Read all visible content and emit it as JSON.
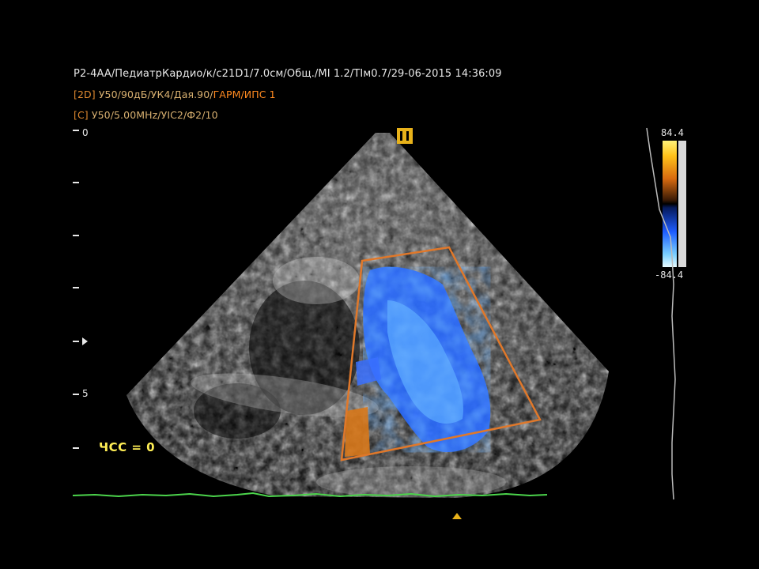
{
  "header": {
    "line1": "P2-4AA/ПедиатрКардио/к/c21D1/7.0см/Общ./MI 1.2/TIм0.7/29-06-2015 14:36:09",
    "line2_tag": "[2D]",
    "line2_rest": "У50/90дБ/УК4/Дая.90/",
    "line2_mode": "ГАРМ/ИПС 1",
    "line3_tag": "[C]",
    "line3_rest": "У50/5.00MHz/УIC2/Ф2/10"
  },
  "depth_scale": {
    "top_label": "0",
    "mid_label": "5"
  },
  "heart_rate": "ЧСС = 0",
  "color_bar": {
    "max_label": "84.4",
    "min_label": "-84.4"
  },
  "colors": {
    "roi_box": "#e0782a",
    "flow_blue": "#2a6bff",
    "flow_orange": "#d8781a",
    "ecg_trace": "#4cd44c",
    "text_yellow": "#ffee55"
  }
}
